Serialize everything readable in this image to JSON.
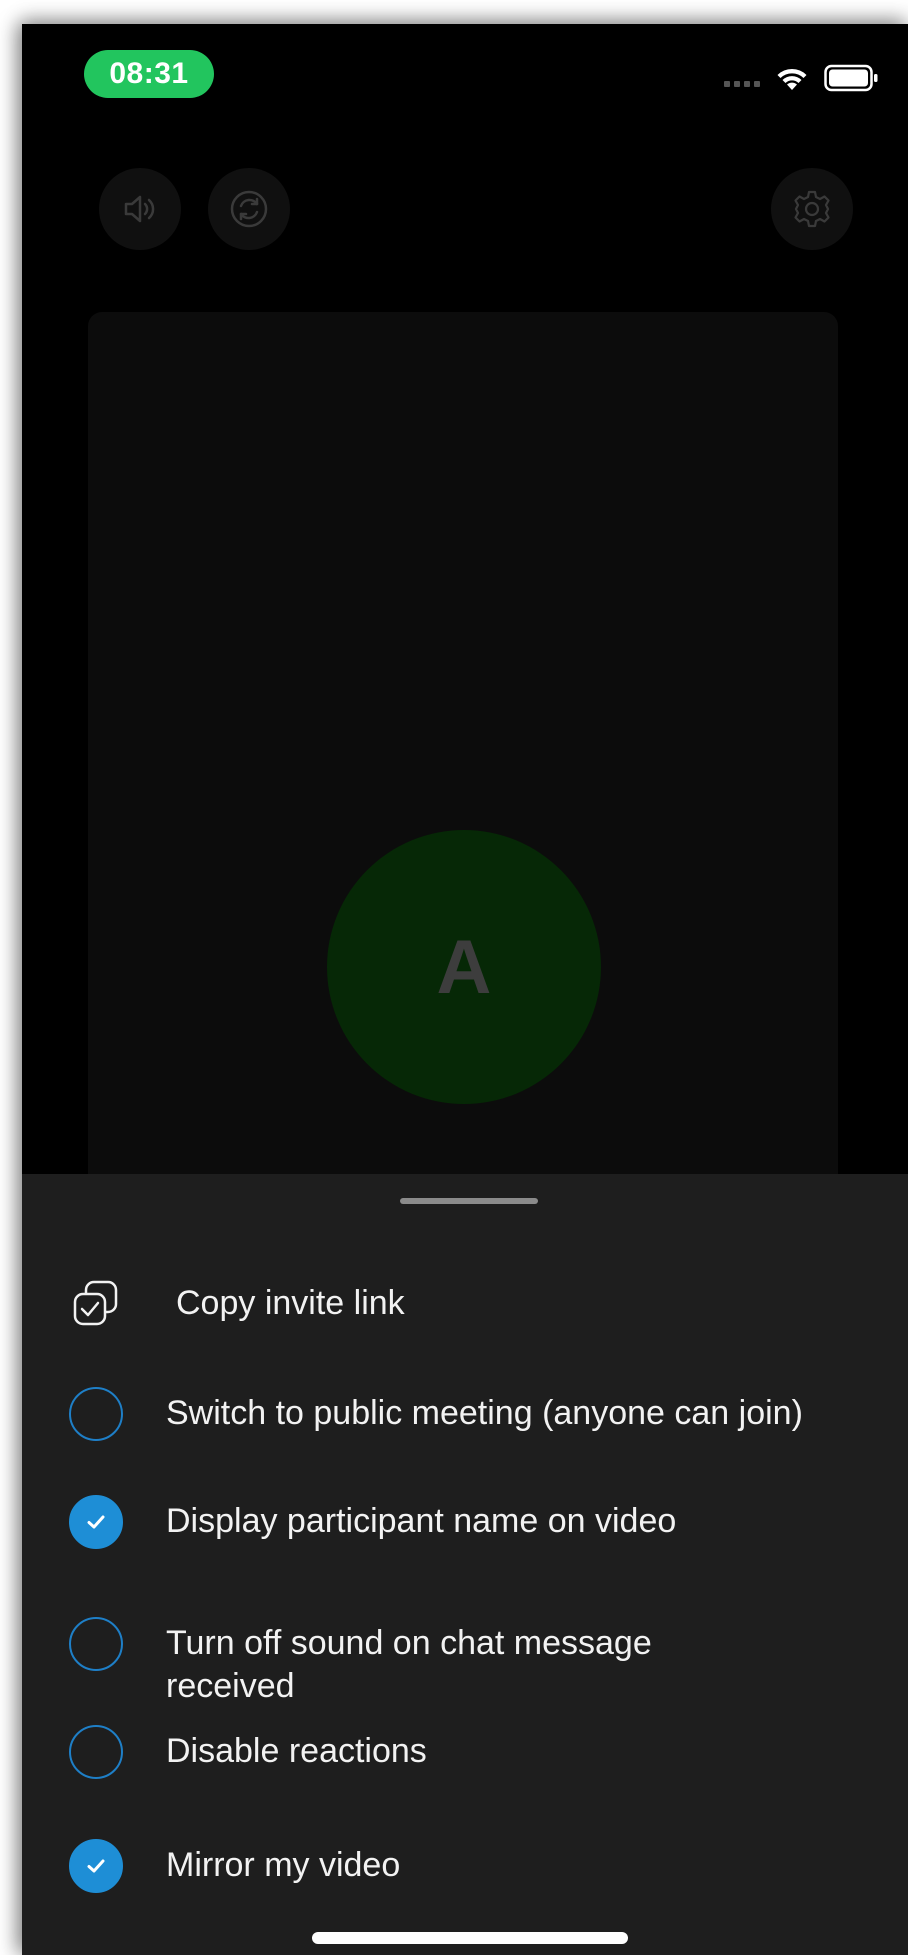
{
  "status_bar": {
    "time": "08:31"
  },
  "controls": {
    "speaker_icon": "speaker-icon",
    "switch_camera_icon": "switch-camera-icon",
    "settings_icon": "gear-icon"
  },
  "video": {
    "avatar_initial": "A"
  },
  "sheet": {
    "items": [
      {
        "label": "Copy invite link",
        "icon": "copy-link-icon"
      },
      {
        "label": " Switch to public meeting (anyone can join)",
        "checked": false
      },
      {
        "label": " Display participant name on video",
        "checked": true
      },
      {
        "label": " Turn off sound on chat message received",
        "checked": false
      },
      {
        "label": " Disable reactions",
        "checked": false
      },
      {
        "label": " Mirror my video",
        "checked": true
      }
    ]
  },
  "colors": {
    "time_pill": "#22c55e",
    "accent": "#1e8ed6",
    "sheet_bg": "#1e1e1e"
  }
}
